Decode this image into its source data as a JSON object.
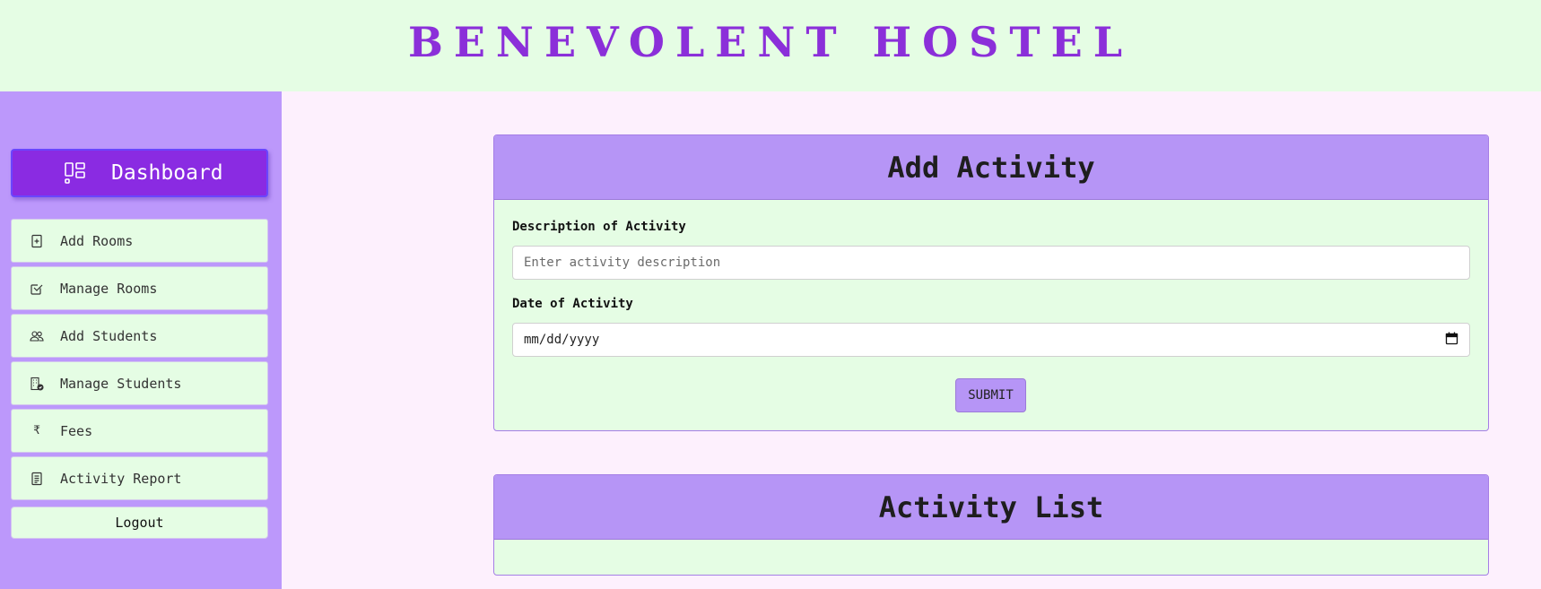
{
  "header": {
    "title": "BENEVOLENT HOSTEL"
  },
  "sidebar": {
    "dashboard": {
      "label": "Dashboard",
      "icon": "dashboard-layout-icon"
    },
    "items": [
      {
        "label": "Add Rooms",
        "icon": "add-file-icon"
      },
      {
        "label": "Manage Rooms",
        "icon": "check-square-icon"
      },
      {
        "label": "Add Students",
        "icon": "people-icon"
      },
      {
        "label": "Manage Students",
        "icon": "building-check-icon"
      },
      {
        "label": "Fees",
        "icon": "rupee-icon"
      },
      {
        "label": "Activity Report",
        "icon": "document-icon"
      }
    ],
    "logout": "Logout"
  },
  "add_activity": {
    "title": "Add Activity",
    "description_label": "Description of Activity",
    "description_placeholder": "Enter activity description",
    "date_label": "Date of Activity",
    "date_placeholder": "mm/dd/yyyy",
    "submit_label": "SUBMIT"
  },
  "activity_list": {
    "title": "Activity List"
  },
  "colors": {
    "header_bg": "#e5fde4",
    "title_color": "#8b2fd9",
    "sidebar_bg": "#bc98fb",
    "dashboard_bg": "#8a2be2",
    "card_head_bg": "#b695f6",
    "page_bg": "#fdf0fd"
  }
}
